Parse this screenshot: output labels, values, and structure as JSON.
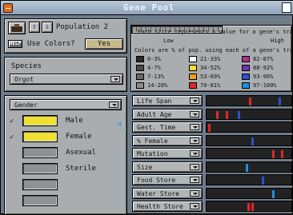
{
  "window": {
    "title": "Gene Pool"
  },
  "toolbar": {
    "population_label": "Population 2",
    "help_label": "HELP",
    "use_colors_label": "Use Colors?",
    "use_colors_value": "Yes"
  },
  "species": {
    "label": "Species",
    "selected": "Orgot"
  },
  "legend": {
    "line1": "Each slice represents a value for a gene's trait:",
    "low": "Low",
    "high": "High",
    "line2": "Colors are % of pop. using each of a gene's traits:",
    "swatches": [
      {
        "label": "0-3%",
        "color": "#2a2a2a"
      },
      {
        "label": "4-7%",
        "color": "#4a4a4a"
      },
      {
        "label": "7-13%",
        "color": "#6a6a6a"
      },
      {
        "label": "14-20%",
        "color": "#8c8c8c"
      },
      {
        "label": "21-33%",
        "color": "#ffffff"
      },
      {
        "label": "34-52%",
        "color": "#f0e030"
      },
      {
        "label": "53-69%",
        "color": "#f0a020"
      },
      {
        "label": "70-81%",
        "color": "#e02828"
      },
      {
        "label": "82-87%",
        "color": "#b03090"
      },
      {
        "label": "88-92%",
        "color": "#7830b0"
      },
      {
        "label": "93-96%",
        "color": "#3050d0"
      },
      {
        "label": "97-100%",
        "color": "#2090e0"
      }
    ]
  },
  "gender": {
    "dropdown": "Gender",
    "rows": [
      {
        "check": "✓",
        "label": "Male",
        "fill": "#f0e030"
      },
      {
        "check": "✓",
        "label": "Female",
        "fill": "#f0e030"
      },
      {
        "check": "",
        "label": "Asexual",
        "fill": ""
      },
      {
        "check": "",
        "label": "Sterile",
        "fill": ""
      },
      {
        "check": "",
        "label": "",
        "fill": ""
      },
      {
        "check": "",
        "label": "",
        "fill": ""
      }
    ]
  },
  "genes": [
    {
      "label": "Life Span",
      "ticks": [
        {
          "pos": 0.52,
          "color": "#e02828"
        },
        {
          "pos": 0.88,
          "color": "#3050d0"
        }
      ]
    },
    {
      "label": "Adult Age",
      "ticks": [
        {
          "pos": 0.12,
          "color": "#e02828"
        },
        {
          "pos": 0.24,
          "color": "#e02828"
        },
        {
          "pos": 0.38,
          "color": "#3050d0"
        }
      ]
    },
    {
      "label": "Gest. Time",
      "ticks": [
        {
          "pos": 0.02,
          "color": "#e02828"
        }
      ]
    },
    {
      "label": "% Female",
      "ticks": [
        {
          "pos": 0.55,
          "color": "#3050d0"
        }
      ]
    },
    {
      "label": "Mutation",
      "ticks": [
        {
          "pos": 0.8,
          "color": "#e02828"
        },
        {
          "pos": 0.91,
          "color": "#e02828"
        }
      ]
    },
    {
      "label": "Size",
      "ticks": [
        {
          "pos": 0.48,
          "color": "#2090e0"
        }
      ]
    },
    {
      "label": "Food Store",
      "ticks": [
        {
          "pos": 0.68,
          "color": "#3050d0"
        }
      ]
    },
    {
      "label": "Water Store",
      "ticks": [
        {
          "pos": 0.8,
          "color": "#2090e0"
        }
      ]
    },
    {
      "label": "Health Store",
      "ticks": [
        {
          "pos": 0.5,
          "color": "#e02828"
        },
        {
          "pos": 0.55,
          "color": "#e02828"
        }
      ]
    }
  ]
}
